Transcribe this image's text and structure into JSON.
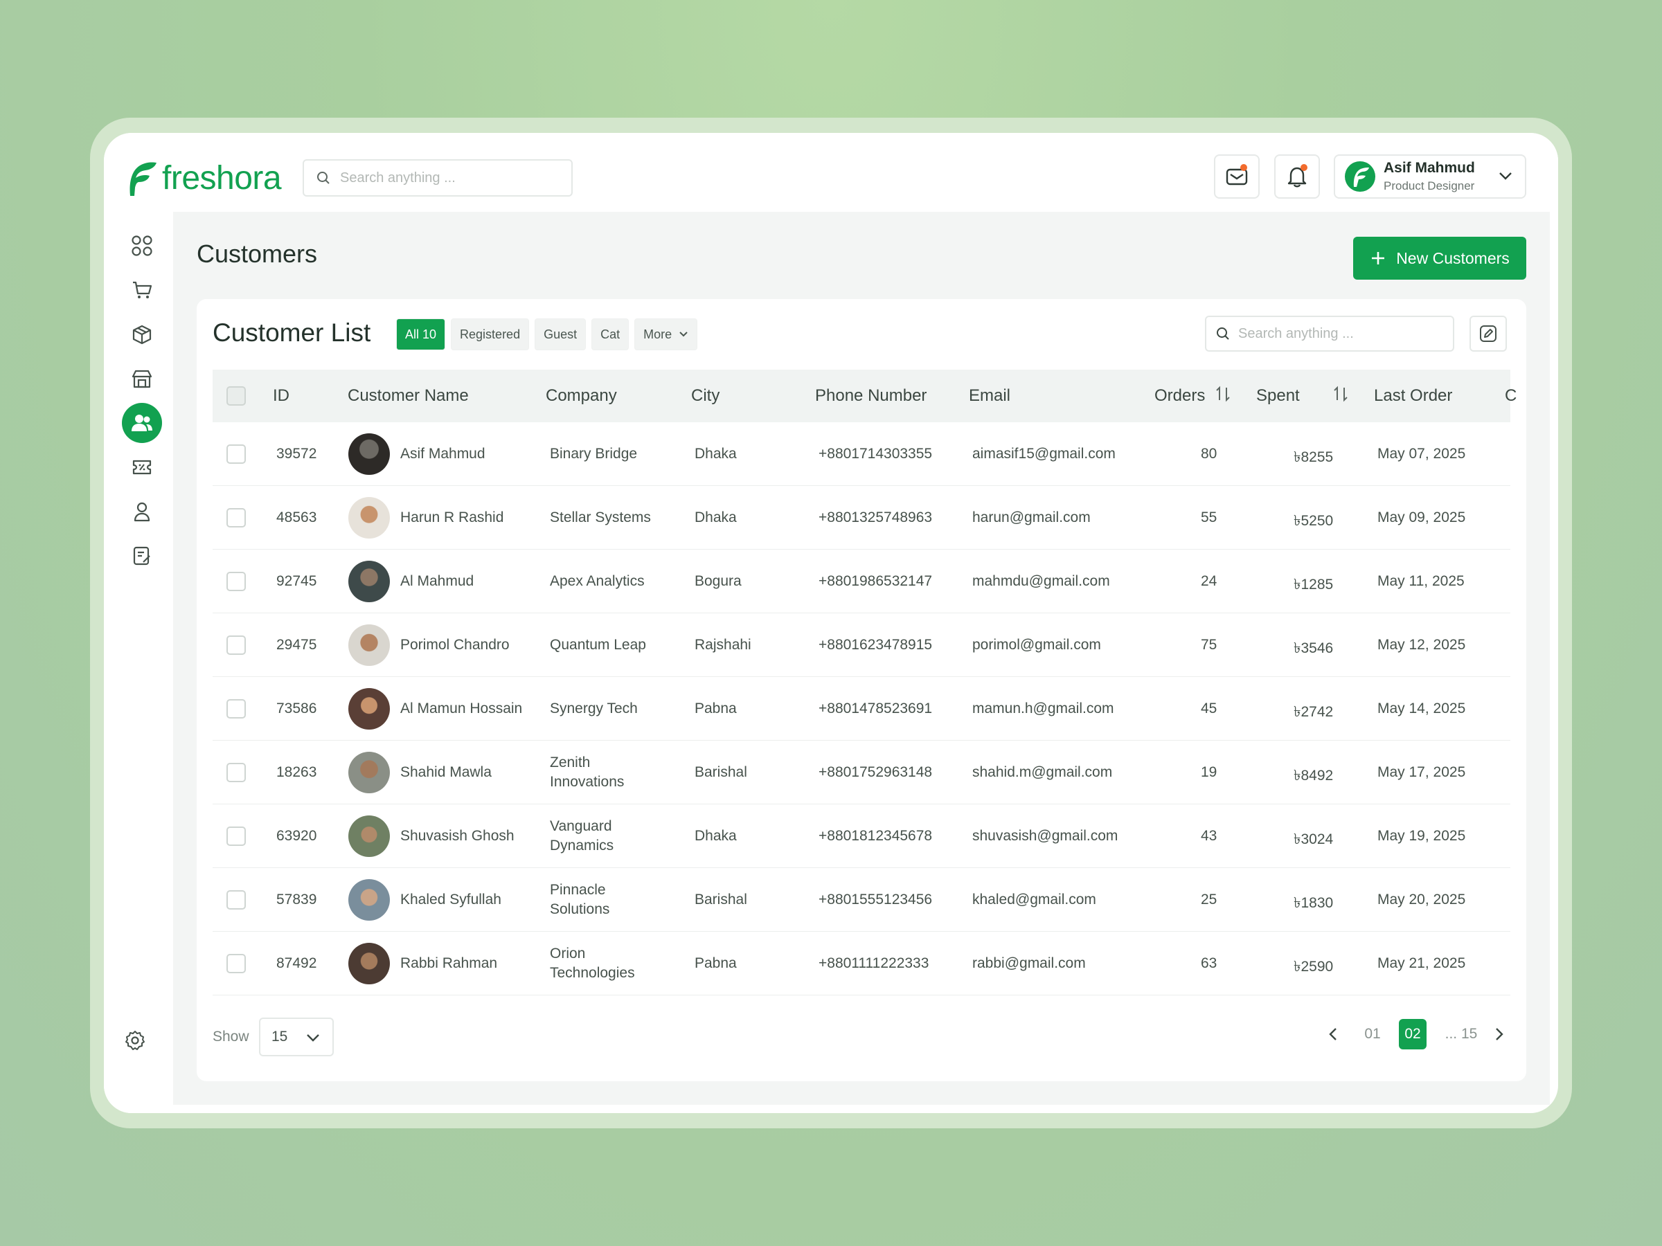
{
  "app": {
    "name": "freshora",
    "search_placeholder": "Search anything ...",
    "accent": "#12a150"
  },
  "user": {
    "name": "Asif Mahmud",
    "role": "Product Designer"
  },
  "sidebar": [
    "dashboard-icon",
    "cart-icon",
    "box-icon",
    "store-icon",
    "customers-icon",
    "ticket-icon",
    "user-icon",
    "report-icon",
    "settings-icon"
  ],
  "page": {
    "title": "Customers",
    "new_button": "New Customers"
  },
  "list": {
    "title": "Customer List",
    "filters": [
      "All 10",
      "Registered",
      "Guest",
      "Cat",
      "More"
    ],
    "search_placeholder": "Search anything ...",
    "headers": {
      "id": "ID",
      "name": "Customer Name",
      "company": "Company",
      "city": "City",
      "phone": "Phone Number",
      "email": "Email",
      "orders": "Orders",
      "spent": "Spent",
      "last": "Last Order",
      "extra": "C"
    },
    "rows": [
      {
        "id": "39572",
        "name": "Asif Mahmud",
        "company": "Binary Bridge",
        "city": "Dhaka",
        "phone": "+8801714303355",
        "email": "aimasif15@gmail.com",
        "orders": "80",
        "spent": "৳8255",
        "last": "May 07, 2025"
      },
      {
        "id": "48563",
        "name": "Harun R Rashid",
        "company": "Stellar Systems",
        "city": "Dhaka",
        "phone": "+8801325748963",
        "email": "harun@gmail.com",
        "orders": "55",
        "spent": "৳5250",
        "last": "May 09, 2025"
      },
      {
        "id": "92745",
        "name": "Al Mahmud",
        "company": "Apex Analytics",
        "city": "Bogura",
        "phone": "+8801986532147",
        "email": "mahmdu@gmail.com",
        "orders": "24",
        "spent": "৳1285",
        "last": "May 11, 2025"
      },
      {
        "id": "29475",
        "name": "Porimol Chandro",
        "company": "Quantum Leap",
        "city": "Rajshahi",
        "phone": "+8801623478915",
        "email": "porimol@gmail.com",
        "orders": "75",
        "spent": "৳3546",
        "last": "May 12, 2025"
      },
      {
        "id": "73586",
        "name": "Al Mamun Hossain",
        "company": "Synergy Tech",
        "city": "Pabna",
        "phone": "+8801478523691",
        "email": "mamun.h@gmail.com",
        "orders": "45",
        "spent": "৳2742",
        "last": "May 14, 2025"
      },
      {
        "id": "18263",
        "name": "Shahid Mawla",
        "company": "Zenith Innovations",
        "city": "Barishal",
        "phone": "+8801752963148",
        "email": "shahid.m@gmail.com",
        "orders": "19",
        "spent": "৳8492",
        "last": "May 17, 2025"
      },
      {
        "id": "63920",
        "name": "Shuvasish Ghosh",
        "company": "Vanguard Dynamics",
        "city": "Dhaka",
        "phone": "+8801812345678",
        "email": "shuvasish@gmail.com",
        "orders": "43",
        "spent": "৳3024",
        "last": "May 19, 2025"
      },
      {
        "id": "57839",
        "name": "Khaled Syfullah",
        "company": "Pinnacle Solutions",
        "city": "Barishal",
        "phone": "+8801555123456",
        "email": "khaled@gmail.com",
        "orders": "25",
        "spent": "৳1830",
        "last": "May 20, 2025"
      },
      {
        "id": "87492",
        "name": "Rabbi Rahman",
        "company": "Orion Technologies",
        "city": "Pabna",
        "phone": "+8801111222333",
        "email": "rabbi@gmail.com",
        "orders": "63",
        "spent": "৳2590",
        "last": "May 21, 2025"
      }
    ]
  },
  "footer": {
    "show_label": "Show",
    "show_value": "15",
    "pages": [
      "01",
      "02",
      "... 15"
    ],
    "current_page": "02"
  }
}
